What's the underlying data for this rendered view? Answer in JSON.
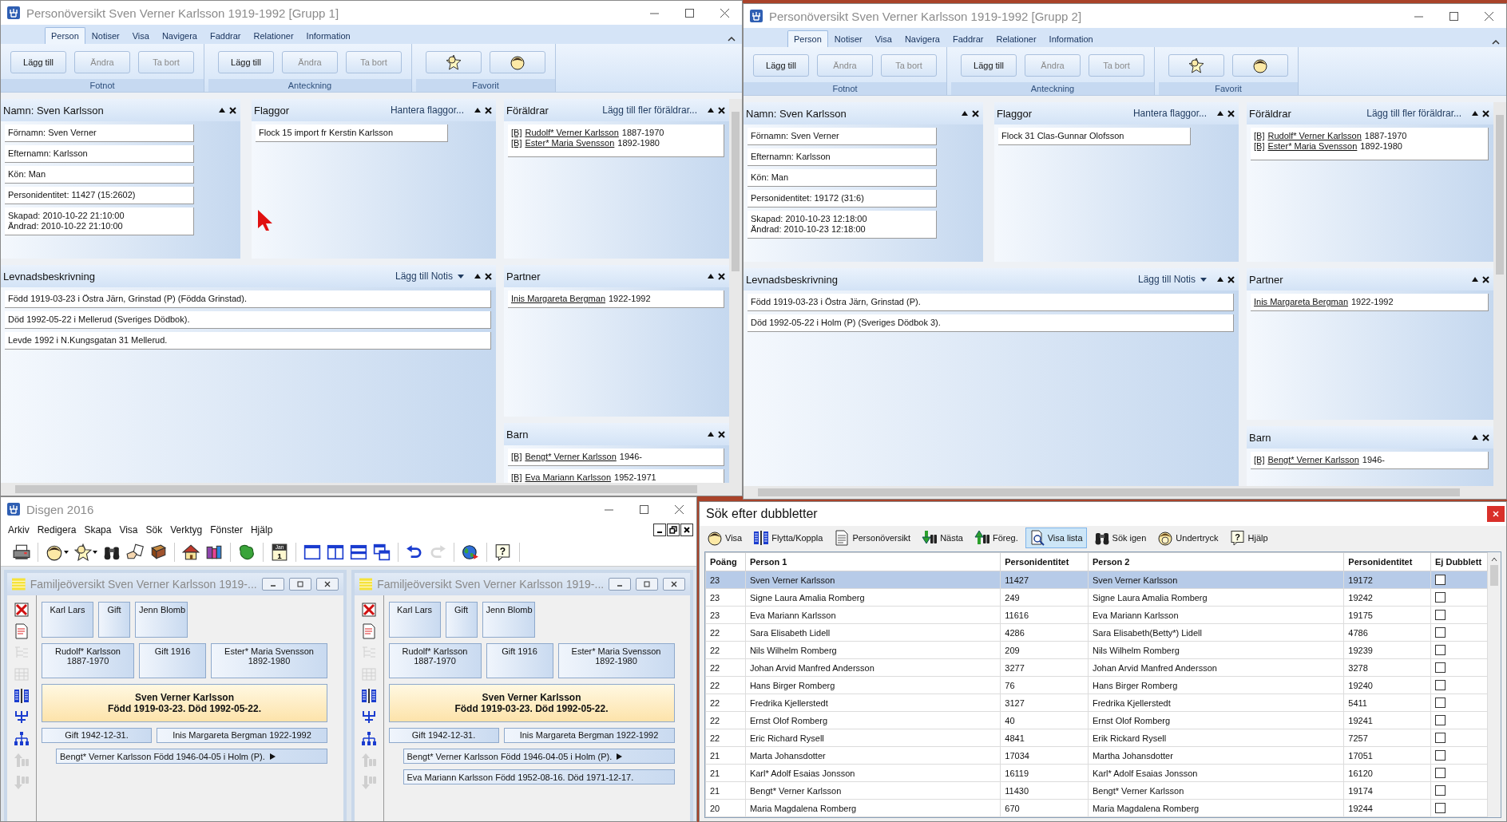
{
  "person_windows": [
    {
      "title": "Personöversikt Sven Verner Karlsson 1919-1992 [Grupp 1]",
      "tabs": [
        {
          "label": "Person",
          "selected": true
        },
        {
          "label": "Notiser",
          "selected": false
        },
        {
          "label": "Visa",
          "selected": false
        },
        {
          "label": "Navigera",
          "selected": false
        },
        {
          "label": "Faddrar",
          "selected": false
        },
        {
          "label": "Relationer",
          "selected": false
        },
        {
          "label": "Information",
          "selected": false
        }
      ],
      "ribbon_groups": [
        {
          "label": "Fotnot",
          "buttons": [
            {
              "kind": "text",
              "label": "Lägg till",
              "disabled": false
            },
            {
              "kind": "text",
              "label": "Ändra",
              "disabled": true
            },
            {
              "kind": "text",
              "label": "Ta bort",
              "disabled": true
            }
          ]
        },
        {
          "label": "Anteckning",
          "buttons": [
            {
              "kind": "text",
              "label": "Lägg till",
              "disabled": false
            },
            {
              "kind": "text",
              "label": "Ändra",
              "disabled": true
            },
            {
              "kind": "text",
              "label": "Ta bort",
              "disabled": true
            }
          ]
        },
        {
          "label": "Favorit",
          "buttons": [
            {
              "kind": "star",
              "disabled": false
            },
            {
              "kind": "face",
              "disabled": false
            }
          ]
        }
      ],
      "name_panel": {
        "title": "Namn: Sven Karlsson",
        "fields": [
          {
            "lines": [
              "Förnamn: Sven Verner"
            ]
          },
          {
            "lines": [
              "Efternamn: Karlsson"
            ]
          },
          {
            "lines": [
              "Kön: Man"
            ]
          },
          {
            "lines": [
              "Personidentitet: 11427 (15:2602)"
            ]
          },
          {
            "lines": [
              "Skapad: 2010-10-22 21:10:00",
              "Ändrad: 2010-10-22 21:10:00"
            ]
          }
        ]
      },
      "flags_panel": {
        "title": "Flaggor",
        "action": "Hantera flaggor...",
        "items": [
          "Flock 15 import fr Kerstin Karlsson"
        ]
      },
      "parents_panel": {
        "title": "Föräldrar",
        "action": "Lägg till fler föräldrar...",
        "items": [
          {
            "tag": "[B]",
            "name": "Rudolf* Verner Karlsson",
            "years": "1887-1970"
          },
          {
            "tag": "[B]",
            "name": "Ester* Maria Svensson",
            "years": "1892-1980"
          }
        ]
      },
      "life_panel": {
        "title": "Levnadsbeskrivning",
        "action": "Lägg till Notis",
        "items": [
          "Född 1919-03-23 i Östra Järn, Grinstad (P) (Födda Grinstad).",
          "Död 1992-05-22 i Mellerud (Sveriges Dödbok).",
          "Levde 1992 i N.Kungsgatan 31 Mellerud."
        ]
      },
      "partner_panel": {
        "title": "Partner",
        "items": [
          {
            "name": "Inis Margareta Bergman",
            "years": "1922-1992"
          }
        ]
      },
      "children_panel": {
        "title": "Barn",
        "items": [
          {
            "tag": "[B]",
            "name": "Bengt* Verner Karlsson",
            "years": "1946-"
          },
          {
            "tag": "[B]",
            "name": "Eva Mariann Karlsson",
            "years": "1952-1971"
          }
        ]
      }
    },
    {
      "title": "Personöversikt Sven Verner Karlsson 1919-1992 [Grupp 2]",
      "tabs": [
        {
          "label": "Person",
          "selected": true
        },
        {
          "label": "Notiser",
          "selected": false
        },
        {
          "label": "Visa",
          "selected": false
        },
        {
          "label": "Navigera",
          "selected": false
        },
        {
          "label": "Faddrar",
          "selected": false
        },
        {
          "label": "Relationer",
          "selected": false
        },
        {
          "label": "Information",
          "selected": false
        }
      ],
      "ribbon_groups": [
        {
          "label": "Fotnot",
          "buttons": [
            {
              "kind": "text",
              "label": "Lägg till",
              "disabled": false
            },
            {
              "kind": "text",
              "label": "Ändra",
              "disabled": true
            },
            {
              "kind": "text",
              "label": "Ta bort",
              "disabled": true
            }
          ]
        },
        {
          "label": "Anteckning",
          "buttons": [
            {
              "kind": "text",
              "label": "Lägg till",
              "disabled": false
            },
            {
              "kind": "text",
              "label": "Ändra",
              "disabled": true
            },
            {
              "kind": "text",
              "label": "Ta bort",
              "disabled": true
            }
          ]
        },
        {
          "label": "Favorit",
          "buttons": [
            {
              "kind": "star",
              "disabled": false
            },
            {
              "kind": "face",
              "disabled": false
            }
          ]
        }
      ],
      "name_panel": {
        "title": "Namn: Sven Karlsson",
        "fields": [
          {
            "lines": [
              "Förnamn: Sven Verner"
            ]
          },
          {
            "lines": [
              "Efternamn: Karlsson"
            ]
          },
          {
            "lines": [
              "Kön: Man"
            ]
          },
          {
            "lines": [
              "Personidentitet: 19172 (31:6)"
            ]
          },
          {
            "lines": [
              "Skapad: 2010-10-23 12:18:00",
              "Ändrad: 2010-10-23 12:18:00"
            ]
          }
        ]
      },
      "flags_panel": {
        "title": "Flaggor",
        "action": "Hantera flaggor...",
        "items": [
          "Flock 31 Clas-Gunnar Olofsson"
        ]
      },
      "parents_panel": {
        "title": "Föräldrar",
        "action": "Lägg till fler föräldrar...",
        "items": [
          {
            "tag": "[B]",
            "name": "Rudolf* Verner Karlsson",
            "years": "1887-1970"
          },
          {
            "tag": "[B]",
            "name": "Ester* Maria Svensson",
            "years": "1892-1980"
          }
        ]
      },
      "life_panel": {
        "title": "Levnadsbeskrivning",
        "action": "Lägg till Notis",
        "items": [
          "Född 1919-03-23 i Östra Järn, Grinstad (P).",
          "Död 1992-05-22 i Holm (P) (Sveriges Dödbok 3)."
        ]
      },
      "partner_panel": {
        "title": "Partner",
        "items": [
          {
            "name": "Inis Margareta Bergman",
            "years": "1922-1992"
          }
        ]
      },
      "children_panel": {
        "title": "Barn",
        "items": [
          {
            "tag": "[B]",
            "name": "Bengt* Verner Karlsson",
            "years": "1946-"
          }
        ]
      }
    }
  ],
  "main_window": {
    "title": "Disgen 2016",
    "menu": [
      "Arkiv",
      "Redigera",
      "Skapa",
      "Visa",
      "Sök",
      "Verktyg",
      "Fönster",
      "Hjälp"
    ],
    "toolbar_groups": [
      [
        {
          "kind": "printer",
          "disabled": false
        }
      ],
      [
        {
          "kind": "face",
          "disabled": false
        },
        {
          "kind": "star",
          "disabled": false
        },
        {
          "kind": "binoculars",
          "disabled": false
        },
        {
          "kind": "hand",
          "disabled": false
        },
        {
          "kind": "book",
          "disabled": false
        }
      ],
      [
        {
          "kind": "house",
          "disabled": false
        },
        {
          "kind": "books",
          "disabled": false
        }
      ],
      [
        {
          "kind": "map",
          "disabled": false
        }
      ],
      [
        {
          "kind": "calendar",
          "disabled": false,
          "month": "Jan",
          "day": "1"
        }
      ],
      [
        {
          "kind": "win-single",
          "disabled": false
        },
        {
          "kind": "win-split",
          "disabled": false
        },
        {
          "kind": "win-rows",
          "disabled": false
        },
        {
          "kind": "win-cascade",
          "disabled": false
        }
      ],
      [
        {
          "kind": "undo",
          "disabled": false
        },
        {
          "kind": "redo",
          "disabled": true
        }
      ],
      [
        {
          "kind": "globe",
          "disabled": false
        }
      ],
      [
        {
          "kind": "help",
          "disabled": false,
          "glyph": "?"
        }
      ]
    ]
  },
  "family_windows": [
    {
      "title": "Familjeöversikt Sven Verner Karlsson 1919-...",
      "side_tools": [
        {
          "kind": "delete",
          "disabled": false
        },
        {
          "kind": "note",
          "disabled": false
        },
        {
          "kind": "tree",
          "disabled": true
        },
        {
          "kind": "chart",
          "disabled": true
        },
        {
          "kind": "columns",
          "disabled": false
        },
        {
          "kind": "fork",
          "disabled": false
        },
        {
          "kind": "org",
          "disabled": false
        },
        {
          "kind": "up",
          "disabled": true
        },
        {
          "kind": "down",
          "disabled": true
        }
      ],
      "grandparents": [
        "Karl Lars",
        "Gift",
        "Jenn Blomb"
      ],
      "parents": [
        {
          "lines": [
            "Rudolf* Karlsson",
            "1887-1970"
          ]
        },
        {
          "lines": [
            "Gift 1916"
          ]
        },
        {
          "lines": [
            "Ester* Maria Svensson",
            "1892-1980"
          ]
        }
      ],
      "main": {
        "lines": [
          "Sven Verner Karlsson",
          "Född 1919-03-23. Död 1992-05-22."
        ]
      },
      "marriage": [
        "Gift 1942-12-31.",
        "Inis Margareta Bergman 1922-1992"
      ],
      "children": [
        {
          "text": "Bengt* Verner Karlsson Född 1946-04-05 i Holm (P).",
          "has_more": true
        }
      ]
    },
    {
      "title": "Familjeöversikt Sven Verner Karlsson 1919-...",
      "side_tools": [
        {
          "kind": "delete",
          "disabled": false
        },
        {
          "kind": "note",
          "disabled": false
        },
        {
          "kind": "tree",
          "disabled": true
        },
        {
          "kind": "chart",
          "disabled": true
        },
        {
          "kind": "columns",
          "disabled": false
        },
        {
          "kind": "fork",
          "disabled": false
        },
        {
          "kind": "org",
          "disabled": false
        },
        {
          "kind": "up",
          "disabled": true
        },
        {
          "kind": "down",
          "disabled": true
        }
      ],
      "grandparents": [
        "Karl Lars",
        "Gift",
        "Jenn Blomb"
      ],
      "parents": [
        {
          "lines": [
            "Rudolf* Karlsson",
            "1887-1970"
          ]
        },
        {
          "lines": [
            "Gift 1916"
          ]
        },
        {
          "lines": [
            "Ester* Maria Svensson",
            "1892-1980"
          ]
        }
      ],
      "main": {
        "lines": [
          "Sven Verner Karlsson",
          "Född 1919-03-23. Död 1992-05-22."
        ]
      },
      "marriage": [
        "Gift 1942-12-31.",
        "Inis Margareta Bergman 1922-1992"
      ],
      "children": [
        {
          "text": "Bengt* Verner Karlsson Född 1946-04-05 i Holm (P).",
          "has_more": true
        },
        {
          "text": "Eva Mariann Karlsson Född 1952-08-16. Död 1971-12-17.",
          "has_more": false
        }
      ]
    }
  ],
  "duplicates_window": {
    "title": "Sök efter dubbletter",
    "toolbar": [
      {
        "kind": "face",
        "label": "Visa",
        "selected": false
      },
      {
        "kind": "columns",
        "label": "Flytta/Koppla",
        "selected": false
      },
      {
        "kind": "document",
        "label": "Personöversikt",
        "selected": false
      },
      {
        "kind": "next",
        "label": "Nästa",
        "selected": false
      },
      {
        "kind": "prev",
        "label": "Föreg.",
        "selected": false
      },
      {
        "kind": "magnifier",
        "label": "Visa lista",
        "selected": true
      },
      {
        "kind": "binoculars",
        "label": "Sök igen",
        "selected": false
      },
      {
        "kind": "faces",
        "label": "Undertryck",
        "selected": false
      },
      {
        "kind": "help",
        "label": "Hjälp",
        "selected": false,
        "glyph": "?"
      }
    ],
    "columns": [
      "Poäng",
      "Person 1",
      "Personidentitet",
      "Person 2",
      "Personidentitet",
      "Ej Dubblett"
    ],
    "rows": [
      {
        "cells": [
          "23",
          "Sven Verner Karlsson",
          "11427",
          "Sven Verner Karlsson",
          "19172"
        ],
        "selected": true,
        "checked": false
      },
      {
        "cells": [
          "23",
          "Signe Laura Amalia Romberg",
          "249",
          "Signe Laura Amalia Romberg",
          "19242"
        ],
        "selected": false,
        "checked": false
      },
      {
        "cells": [
          "23",
          "Eva Mariann Karlsson",
          "11616",
          "Eva Mariann Karlsson",
          "19175"
        ],
        "selected": false,
        "checked": false
      },
      {
        "cells": [
          "22",
          "Sara Elisabeth Lidell",
          "4286",
          "Sara Elisabeth(Betty*) Lidell",
          "4786"
        ],
        "selected": false,
        "checked": false
      },
      {
        "cells": [
          "22",
          "Nils Wilhelm Romberg",
          "209",
          "Nils Wilhelm Romberg",
          "19239"
        ],
        "selected": false,
        "checked": false
      },
      {
        "cells": [
          "22",
          "Johan Arvid Manfred Andersson",
          "3277",
          "Johan Arvid Manfred Andersson",
          "3278"
        ],
        "selected": false,
        "checked": false
      },
      {
        "cells": [
          "22",
          "Hans Birger Romberg",
          "76",
          "Hans Birger Romberg",
          "19240"
        ],
        "selected": false,
        "checked": false
      },
      {
        "cells": [
          "22",
          "Fredrika Kjellerstedt",
          "3127",
          "Fredrika Kjellerstedt",
          "5411"
        ],
        "selected": false,
        "checked": false
      },
      {
        "cells": [
          "22",
          "Ernst Olof Romberg",
          "40",
          "Ernst Olof Romberg",
          "19241"
        ],
        "selected": false,
        "checked": false
      },
      {
        "cells": [
          "22",
          "Eric Richard Rysell",
          "4841",
          "Erik Rickard Rysell",
          "7257"
        ],
        "selected": false,
        "checked": false
      },
      {
        "cells": [
          "21",
          "Marta Johansdotter",
          "17034",
          "Martha Johansdotter",
          "17051"
        ],
        "selected": false,
        "checked": false
      },
      {
        "cells": [
          "21",
          "Karl* Adolf Esaias Jonsson",
          "16119",
          "Karl* Adolf Esaias Jonsson",
          "16120"
        ],
        "selected": false,
        "checked": false
      },
      {
        "cells": [
          "21",
          "Bengt* Verner Karlsson",
          "11430",
          "Bengt* Verner Karlsson",
          "19174"
        ],
        "selected": false,
        "checked": false
      },
      {
        "cells": [
          "20",
          "Maria Magdalena Romberg",
          "670",
          "Maria Magdalena Romberg",
          "19244"
        ],
        "selected": false,
        "checked": false
      }
    ]
  }
}
